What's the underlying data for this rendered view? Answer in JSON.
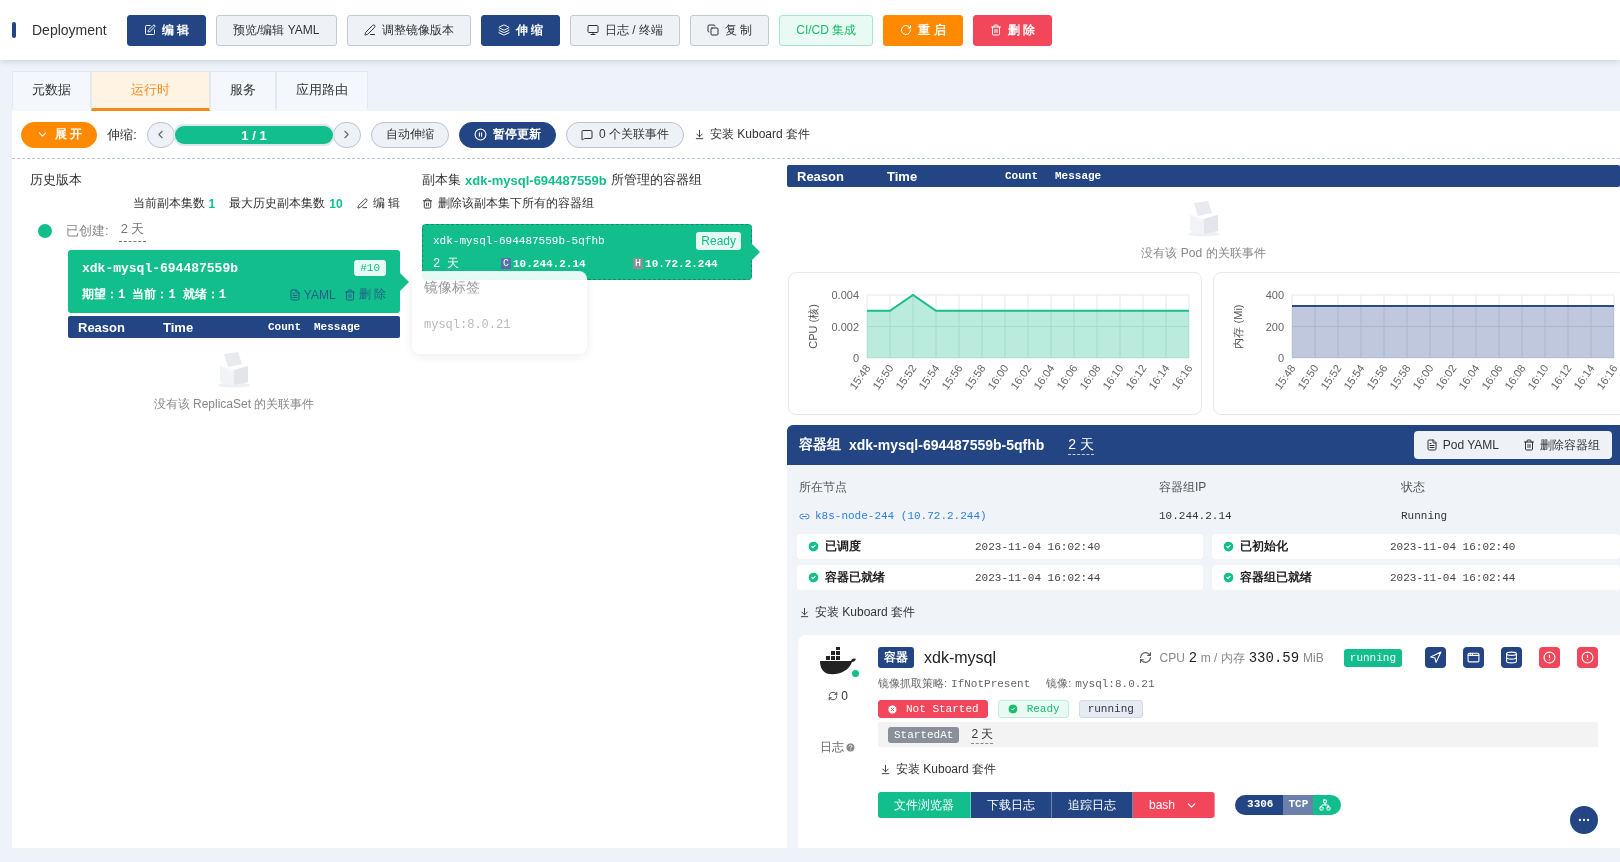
{
  "header": {
    "title": "Deployment",
    "buttons": [
      {
        "label": "编 辑",
        "kind": "primary"
      },
      {
        "label": "预览/编辑 YAML",
        "kind": "default"
      },
      {
        "label": "调整镜像版本",
        "kind": "default"
      },
      {
        "label": "伸 缩",
        "kind": "primary"
      },
      {
        "label": "日志 / 终端",
        "kind": "default"
      },
      {
        "label": "复 制",
        "kind": "default"
      },
      {
        "label": "CI/CD 集成",
        "kind": "success"
      },
      {
        "label": "重 启",
        "kind": "warning"
      },
      {
        "label": "删 除",
        "kind": "danger"
      }
    ]
  },
  "tabs": [
    {
      "label": "元数据",
      "selected": false
    },
    {
      "label": "运行时",
      "selected": true
    },
    {
      "label": "服务",
      "selected": false
    },
    {
      "label": "应用路由",
      "selected": false
    }
  ],
  "toolbar": {
    "expand": "展 开",
    "scale_label": "伸缩:",
    "replicas": "1 / 1",
    "level": 1,
    "auto_scale": "自动伸缩",
    "pause": "暂停更新",
    "events": "0 个关联事件",
    "install": "安装 Kuboard 套件"
  },
  "history": {
    "title": "历史版本",
    "current_label": "当前副本集数",
    "current": "1",
    "max_label": "最大历史副本集数",
    "max": "10",
    "edit": "编 辑",
    "created_label": "已创建:",
    "created": "2 天",
    "replicaset": {
      "name": "xdk-mysql-694487559b",
      "revision": "#10",
      "counts": "期望：1 当前：1 就绪：1",
      "yaml": "YAML",
      "delete": "删 除"
    },
    "events": {
      "columns": [
        "Reason",
        "Time",
        "Count",
        "Message"
      ],
      "empty": "没有该 ReplicaSet 的关联事件"
    }
  },
  "pods": {
    "title_prefix": "副本集",
    "replicaset": "xdk-mysql-694487559b",
    "title_suffix": "所管理的容器组",
    "delete_all": "删除该副本集下所有的容器组",
    "pod": {
      "name": "xdk-mysql-694487559b-5qfhb",
      "status": "Ready",
      "age": "2 天",
      "container_ip_tag": "C",
      "container_ip": "10.244.2.14",
      "host_ip_tag": "H",
      "host_ip": "10.72.2.244"
    },
    "tooltip": {
      "title": "镜像标签",
      "value": "mysql:8.0.21"
    }
  },
  "pod_events": {
    "columns": [
      "Reason",
      "Time",
      "Count",
      "Message"
    ],
    "empty": "没有该 Pod 的关联事件"
  },
  "charts": [
    {
      "chart_data": {
        "type": "area",
        "ylabel": "CPU (核)",
        "grid": true,
        "categories": [
          "15:48",
          "15:50",
          "15:52",
          "15:54",
          "15:56",
          "15:58",
          "16:00",
          "16:02",
          "16:04",
          "16:06",
          "16:08",
          "16:10",
          "16:12",
          "16:14",
          "16:16"
        ],
        "series": [
          {
            "color": "#19be8c",
            "values": [
              0.003,
              0.003,
              0.004,
              0.003,
              0.003,
              0.003,
              0.003,
              0.003,
              0.003,
              0.003,
              0.003,
              0.003,
              0.003,
              0.003,
              0.003
            ]
          }
        ],
        "ylim": [
          0,
          0.004
        ],
        "yticks": [
          {
            "value": 0,
            "label": "0"
          },
          {
            "value": 0.002,
            "label": "0.002"
          },
          {
            "value": 0.004,
            "label": "0.004"
          }
        ]
      }
    },
    {
      "chart_data": {
        "type": "area",
        "ylabel": "内存 (Mi)",
        "grid": true,
        "categories": [
          "15:48",
          "15:50",
          "15:52",
          "15:54",
          "15:56",
          "15:58",
          "16:00",
          "16:02",
          "16:04",
          "16:06",
          "16:08",
          "16:10",
          "16:12",
          "16:14",
          "16:16"
        ],
        "series": [
          {
            "color": "#2a4a8a",
            "values": [
              330,
              330,
              330,
              330,
              330,
              330,
              330,
              330,
              330,
              330,
              330,
              330,
              330,
              330,
              330
            ]
          }
        ],
        "ylim": [
          0,
          400
        ],
        "yticks": [
          {
            "value": 0,
            "label": "0"
          },
          {
            "value": 200,
            "label": "200"
          },
          {
            "value": 400,
            "label": "400"
          }
        ]
      }
    }
  ],
  "pod_detail": {
    "label": "容器组",
    "name": "xdk-mysql-694487559b-5qfhb",
    "age": "2 天",
    "buttons": [
      "Pod YAML",
      "删除容器组"
    ],
    "fields": [
      {
        "label": "所在节点",
        "value": "k8s-node-244 (10.72.2.244)",
        "kind": "link"
      },
      {
        "label": "容器组IP",
        "value": "10.244.2.14",
        "kind": "text"
      },
      {
        "label": "状态",
        "value": "Running",
        "kind": "text"
      }
    ],
    "conditions": [
      {
        "label": "已调度",
        "time": "2023-11-04 16:02:40"
      },
      {
        "label": "已初始化",
        "time": "2023-11-04 16:02:40"
      },
      {
        "label": "容器已就绪",
        "time": "2023-11-04 16:02:44"
      },
      {
        "label": "容器组已就绪",
        "time": "2023-11-04 16:02:44"
      }
    ],
    "install": "安装 Kuboard 套件",
    "container": {
      "restarts": "0",
      "logs_label": "日志",
      "tag": "容器",
      "name": "xdk-mysql",
      "cpu_label": "CPU",
      "cpu": "2",
      "cpu_unit": "m / 内存",
      "memory": "330.59",
      "memory_unit": "MiB",
      "state": "running",
      "tools": [
        {
          "kind": "primary"
        },
        {
          "kind": "primary"
        },
        {
          "kind": "primary"
        },
        {
          "kind": "danger"
        },
        {
          "kind": "danger"
        }
      ],
      "pull_policy_label": "镜像抓取策略:",
      "pull_policy": "IfNotPresent",
      "image_label": "镜像:",
      "image": "mysql:8.0.21",
      "statuses": [
        {
          "label": "Not Started",
          "kind": "error"
        },
        {
          "label": "Ready",
          "kind": "ok"
        },
        {
          "label": "running",
          "kind": "plain"
        }
      ],
      "started_label": "StartedAt",
      "started": "2 天",
      "install": "安装 Kuboard 套件",
      "actions": [
        {
          "label": "文件浏览器",
          "kind": "success"
        },
        {
          "label": "下载日志",
          "kind": "primary"
        },
        {
          "label": "追踪日志",
          "kind": "primary"
        },
        {
          "label": "bash",
          "kind": "danger"
        }
      ],
      "port": {
        "number": "3306",
        "protocol": "TCP"
      }
    }
  }
}
